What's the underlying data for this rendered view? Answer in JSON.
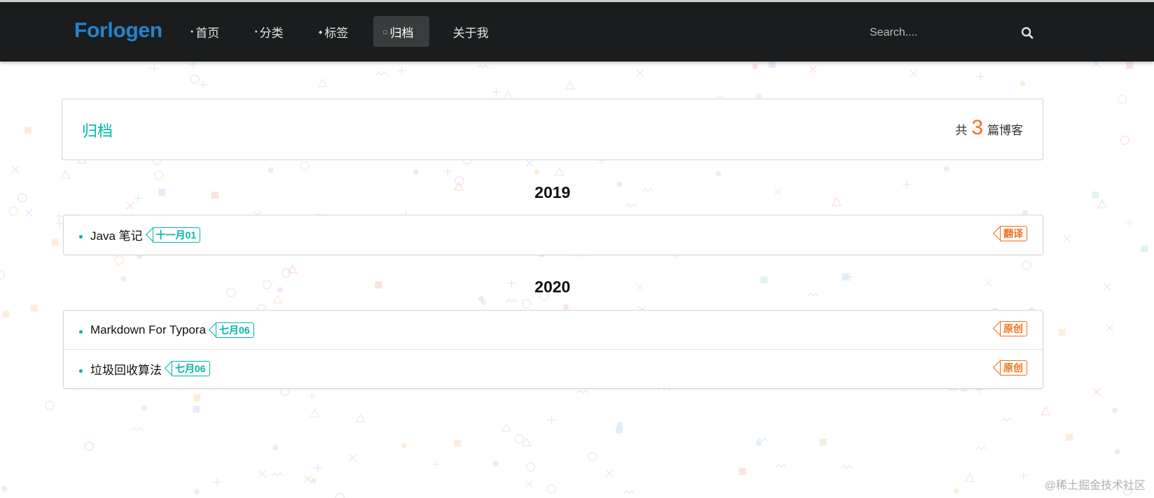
{
  "navbar": {
    "logo": "Forlogen",
    "items": [
      {
        "label": "首页",
        "icon": "home-icon",
        "active": false
      },
      {
        "label": "分类",
        "icon": "idea-icon",
        "active": false
      },
      {
        "label": "标签",
        "icon": "tags-icon",
        "active": false
      },
      {
        "label": "归档",
        "icon": "clone-icon",
        "active": true
      },
      {
        "label": "关于我",
        "icon": "info-icon",
        "active": false
      }
    ],
    "search": {
      "placeholder": "Search...."
    }
  },
  "archive_header": {
    "title": "归档",
    "count_prefix": "共",
    "count": "3",
    "count_suffix": "篇博客"
  },
  "years": [
    {
      "year": "2019",
      "posts": [
        {
          "title": "Java 笔记",
          "date": "十一月01",
          "type": "翻译"
        }
      ]
    },
    {
      "year": "2020",
      "posts": [
        {
          "title": "Markdown For Typora",
          "date": "七月06",
          "type": "原创"
        },
        {
          "title": "垃圾回收算法",
          "date": "七月06",
          "type": "原创"
        }
      ]
    }
  ],
  "watermark": "@稀土掘金技术社区",
  "colors": {
    "navbar_bg": "#1b1c1d",
    "logo": "#2185d0",
    "teal": "#00b5ad",
    "orange": "#f2711c"
  }
}
